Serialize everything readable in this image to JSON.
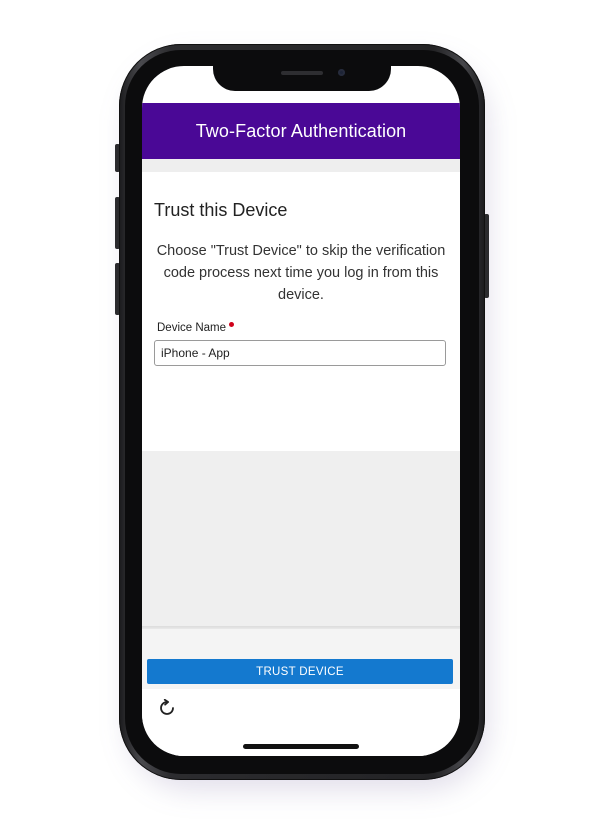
{
  "header": {
    "title": "Two-Factor Authentication",
    "background_color": "#4a0896"
  },
  "trust_card": {
    "title": "Trust this Device",
    "description": "Choose \"Trust Device\" to skip the verification code process next time you log in from this device.",
    "device_name_label": "Device Name",
    "device_name_required": true,
    "device_name_value": "iPhone - App"
  },
  "footer": {
    "trust_button_label": "TRUST DEVICE",
    "trust_button_color": "#1479cf",
    "refresh_icon": "refresh-icon"
  },
  "colors": {
    "required_marker": "#d0021b",
    "page_gray": "#efefef"
  }
}
